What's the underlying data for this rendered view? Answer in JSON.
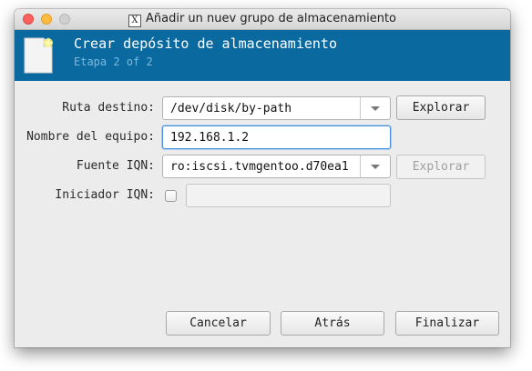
{
  "window": {
    "title": "Añadir un nuev grupo de almacenamiento",
    "app_icon_glyph": "X"
  },
  "header": {
    "title": "Crear depósito de almacenamiento",
    "subtitle": "Etapa 2 of 2",
    "background_color": "#0a6aa0",
    "icon": "new-document-icon"
  },
  "form": {
    "target_path": {
      "label": "Ruta destino:",
      "value": "/dev/disk/by-path",
      "browse_label": "Explorar"
    },
    "host_name": {
      "label": "Nombre del equipo:",
      "value": "192.168.1.2"
    },
    "source_iqn": {
      "label": "Fuente IQN:",
      "value": "ro:iscsi.tvmgentoo.d70ea1",
      "browse_label": "Explorar"
    },
    "initiator_iqn": {
      "label": "Iniciador IQN:",
      "value": "",
      "checked": false
    }
  },
  "buttons": {
    "cancel": "Cancelar",
    "back": "Atrás",
    "finish": "Finalizar"
  }
}
